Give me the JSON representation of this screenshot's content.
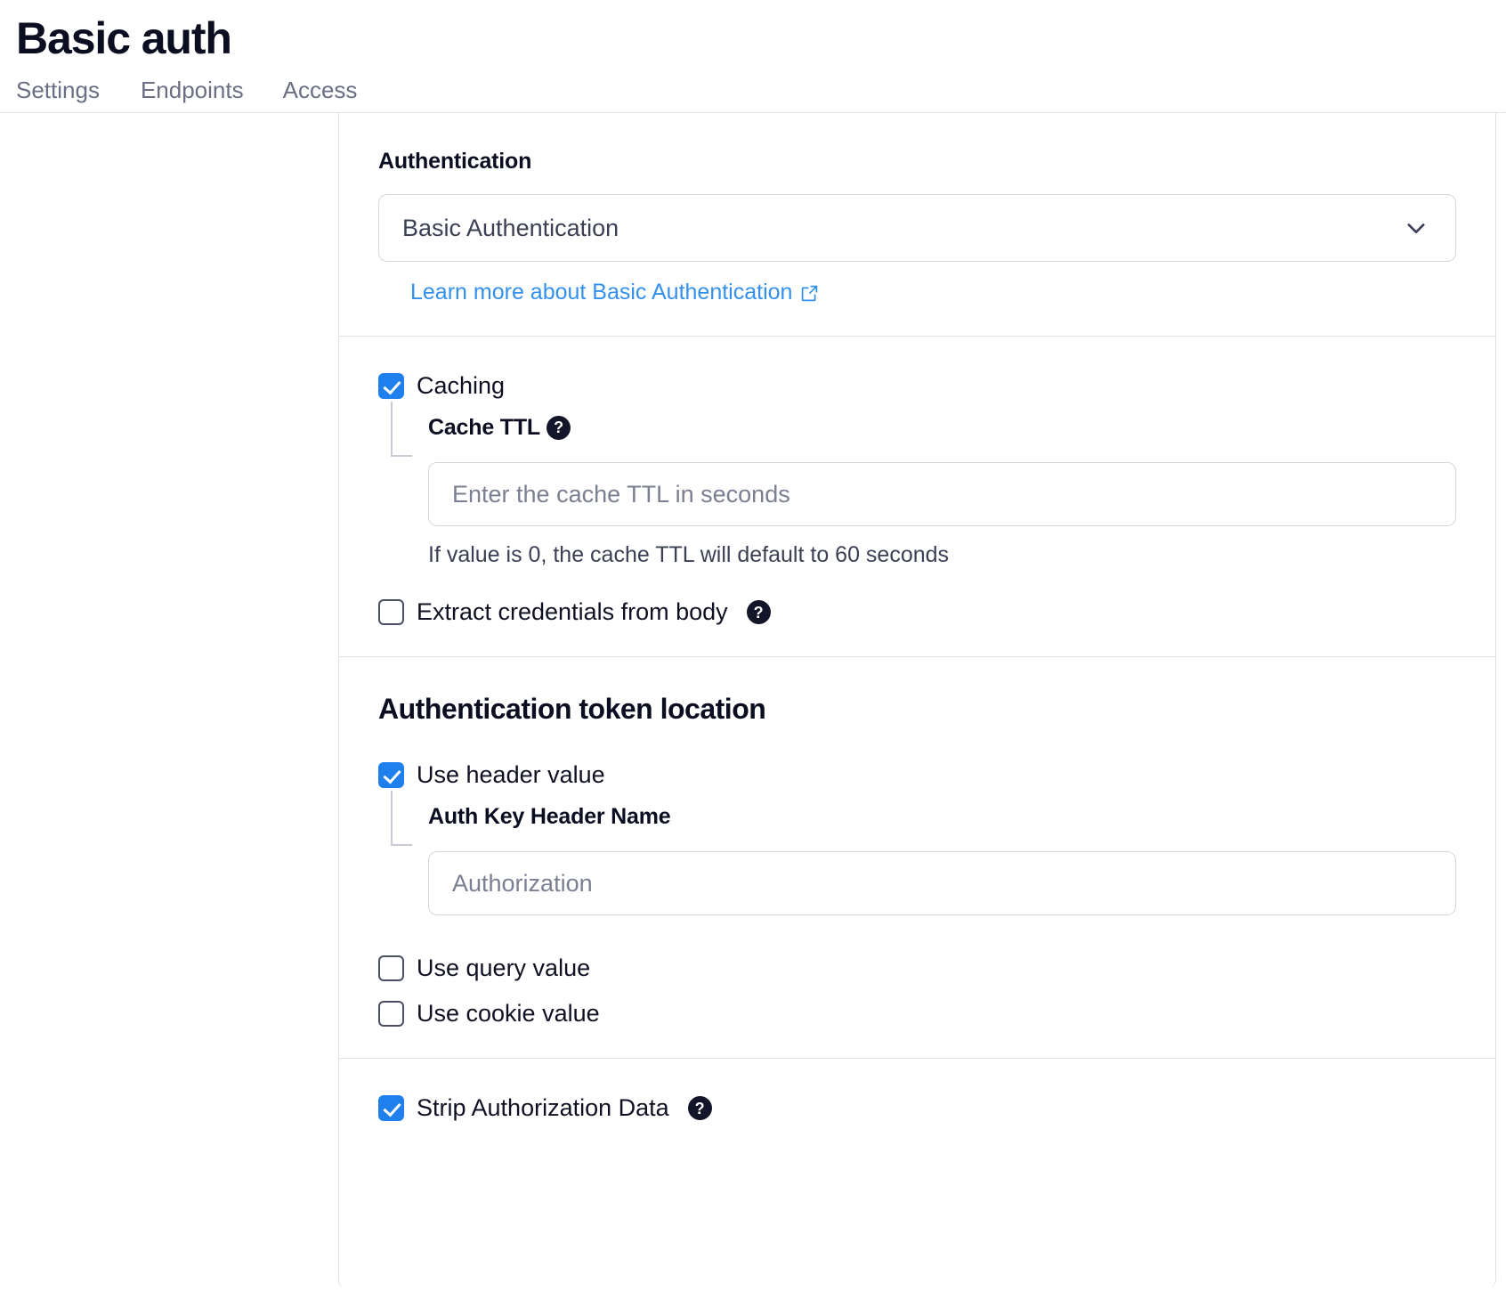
{
  "header": {
    "title": "Basic auth"
  },
  "tabs": [
    {
      "label": "Settings",
      "active": false
    },
    {
      "label": "Endpoints",
      "active": false
    },
    {
      "label": "Access",
      "active": false
    }
  ],
  "auth_section": {
    "label": "Authentication",
    "select_value": "Basic Authentication",
    "chevron_icon": "chevron-down-icon",
    "learn_more_link": "Learn more about Basic Authentication",
    "external_link_icon": "external-link-icon"
  },
  "caching_section": {
    "caching": {
      "label": "Caching",
      "checked": true
    },
    "cache_ttl": {
      "label": "Cache TTL",
      "help_icon": "?",
      "placeholder": "Enter the cache TTL in seconds",
      "value": "",
      "hint": "If value is 0, the cache TTL will default to 60 seconds"
    },
    "extract_credentials": {
      "label": "Extract credentials from body",
      "checked": false,
      "help_icon": "?"
    }
  },
  "token_location_section": {
    "heading": "Authentication token location",
    "use_header_value": {
      "label": "Use header value",
      "checked": true
    },
    "auth_key_header_name": {
      "label": "Auth Key Header Name",
      "placeholder": "Authorization",
      "value": ""
    },
    "use_query_value": {
      "label": "Use query value",
      "checked": false
    },
    "use_cookie_value": {
      "label": "Use cookie value",
      "checked": false
    }
  },
  "strip_section": {
    "strip_authorization_data": {
      "label": "Strip Authorization Data",
      "checked": true,
      "help_icon": "?"
    }
  },
  "colors": {
    "accent_blue": "#1f7fec",
    "link_blue": "#3390ec",
    "text_dark": "#0f1123",
    "text_muted": "#6b6f84",
    "border": "#dfe1e6"
  }
}
